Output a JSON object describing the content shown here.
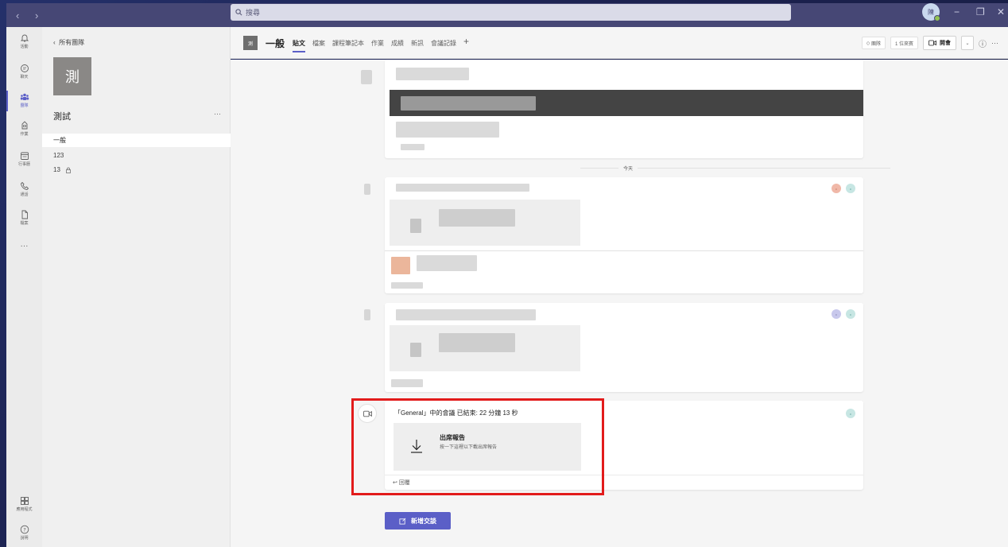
{
  "titlebar": {
    "search_placeholder": "搜尋",
    "avatar_initial": "陳"
  },
  "rail": {
    "items": [
      {
        "label": "活動",
        "icon": "bell-icon"
      },
      {
        "label": "聊天",
        "icon": "chat-icon"
      },
      {
        "label": "團隊",
        "icon": "teams-icon"
      },
      {
        "label": "作業",
        "icon": "assignments-icon"
      },
      {
        "label": "行事曆",
        "icon": "calendar-icon"
      },
      {
        "label": "通話",
        "icon": "phone-icon"
      },
      {
        "label": "檔案",
        "icon": "file-icon"
      }
    ],
    "more": "···",
    "apps_label": "應用程式",
    "help_label": "說明"
  },
  "team": {
    "back_label": "所有團隊",
    "tile_char": "測",
    "name": "測試",
    "more": "···",
    "channels": [
      "一般",
      "123",
      "13"
    ]
  },
  "header": {
    "tile_char": "測",
    "title": "一般",
    "tabs": [
      "貼文",
      "檔案",
      "課程筆記本",
      "作業",
      "成績",
      "新訊",
      "會議記錄"
    ],
    "team_label": "團隊",
    "guest_label": "1 位來賓",
    "meet_label": "開會"
  },
  "feed": {
    "today_label": "今天",
    "meeting": {
      "text": "「General」中的會議 已結束: 22 分鐘 13 秒",
      "report_title": "出席報告",
      "report_sub": "按一下這裡以下載出席報告",
      "reply_label": "回覆"
    },
    "new_conversation_label": "新增交談"
  }
}
